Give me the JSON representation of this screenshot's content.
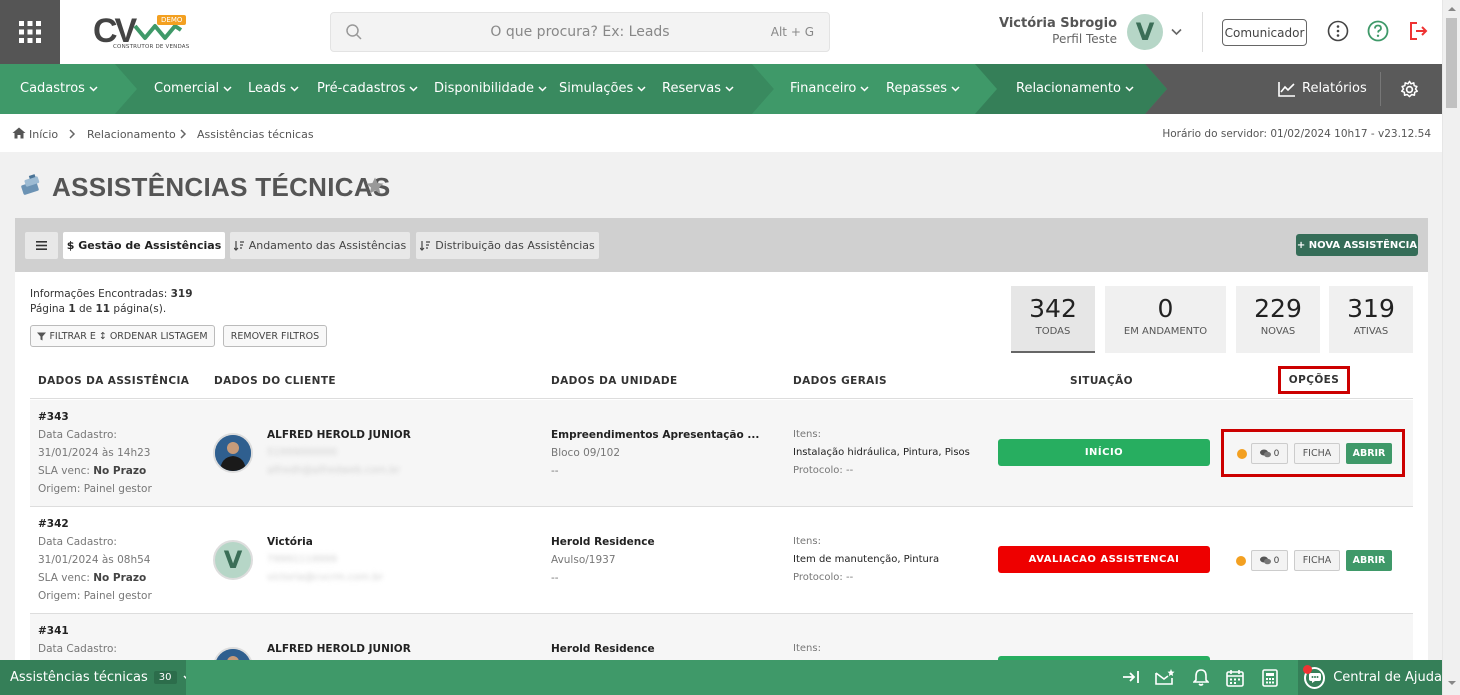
{
  "header": {
    "logo": {
      "text": "CV",
      "badge": "DEMO",
      "tagline": "CONSTRUTOR DE VENDAS"
    },
    "search": {
      "placeholder": "O que procura? Ex: Leads",
      "shortcut": "Alt + G"
    },
    "user": {
      "name": "Victória Sbrogio",
      "profile": "Perfil Teste",
      "initial": "V"
    },
    "communicator_label": "Comunicador"
  },
  "nav": {
    "items": [
      "Cadastros",
      "Comercial",
      "Leads",
      "Pré-cadastros",
      "Disponibilidade",
      "Simulações",
      "Reservas",
      "Financeiro",
      "Repasses",
      "Relacionamento"
    ],
    "reports_label": "Relatórios"
  },
  "breadcrumb": {
    "items": [
      "Início",
      "Relacionamento",
      "Assistências técnicas"
    ],
    "server_time": "Horário do servidor: 01/02/2024 10h17 - v23.12.54"
  },
  "page": {
    "title": "ASSISTÊNCIAS TÉCNICAS"
  },
  "tabs": {
    "items": [
      "$ Gestão de Assistências",
      "Andamento das Assistências",
      "Distribuição das Assistências"
    ],
    "new_button": "+ NOVA ASSISTÊNCIA"
  },
  "info": {
    "found_label": "Informações Encontradas:",
    "found_value": "319",
    "page_pre": "Página",
    "page_value": "1",
    "page_mid": "de",
    "page_total": "11",
    "page_post": "página(s).",
    "filter_button": "FILTRAR E ↕ ORDENAR LISTAGEM",
    "remove_filters": "REMOVER FILTROS"
  },
  "stats": [
    {
      "value": "342",
      "label": "TODAS"
    },
    {
      "value": "0",
      "label": "EM ANDAMENTO"
    },
    {
      "value": "229",
      "label": "NOVAS"
    },
    {
      "value": "319",
      "label": "ATIVAS"
    }
  ],
  "columns": [
    "DADOS DA ASSISTÊNCIA",
    "DADOS DO CLIENTE",
    "DADOS DA UNIDADE",
    "DADOS GERAIS",
    "SITUAÇÃO",
    "OPÇÕES"
  ],
  "rows": [
    {
      "id": "#343",
      "date_label": "Data Cadastro:",
      "date": "31/01/2024 às 14h23",
      "sla_label": "SLA venc:",
      "sla": "No Prazo",
      "origin": "Origem: Painel gestor",
      "client": "ALFRED HEROLD JUNIOR",
      "phone": "51999000000",
      "email": "alfredh@alfredweb.com.br",
      "unit": "Empreendimentos Apresentação ...",
      "unit_sub": "Bloco 09/102",
      "unit_extra": "--",
      "items_label": "Itens:",
      "items": "Instalação hidráulica, Pintura, Pisos",
      "protocol": "Protocolo: --",
      "status": "INÍCIO",
      "status_color": "#27ae60",
      "chat_count": "0",
      "ficha": "FICHA",
      "abrir": "ABRIR"
    },
    {
      "id": "#342",
      "date_label": "Data Cadastro:",
      "date": "31/01/2024 às 08h54",
      "sla_label": "SLA venc:",
      "sla": "No Prazo",
      "origin": "Origem: Painel gestor",
      "client": "Victória",
      "phone": "79991119999",
      "email": "victoria@cvcrm.com.br",
      "unit": "Herold Residence",
      "unit_sub": "Avulso/1937",
      "unit_extra": "--",
      "items_label": "Itens:",
      "items": "Item de manutenção, Pintura",
      "protocol": "Protocolo: --",
      "status": "AVALIACAO ASSISTENCAI",
      "status_color": "#ee0000",
      "chat_count": "0",
      "ficha": "FICHA",
      "abrir": "ABRIR",
      "initial": "V"
    },
    {
      "id": "#341",
      "date_label": "Data Cadastro:",
      "client": "ALFRED HEROLD JUNIOR",
      "unit": "Herold Residence",
      "items_label": "Itens:"
    }
  ],
  "footer": {
    "module": "Assistências técnicas",
    "count": "30",
    "help": "Central de Ajuda"
  },
  "colors": {
    "primary": "#3f9969",
    "dark_green": "#356d58",
    "success": "#27ae60",
    "danger": "#ee0000",
    "warning": "#f3a021",
    "highlight": "#cc0000"
  }
}
